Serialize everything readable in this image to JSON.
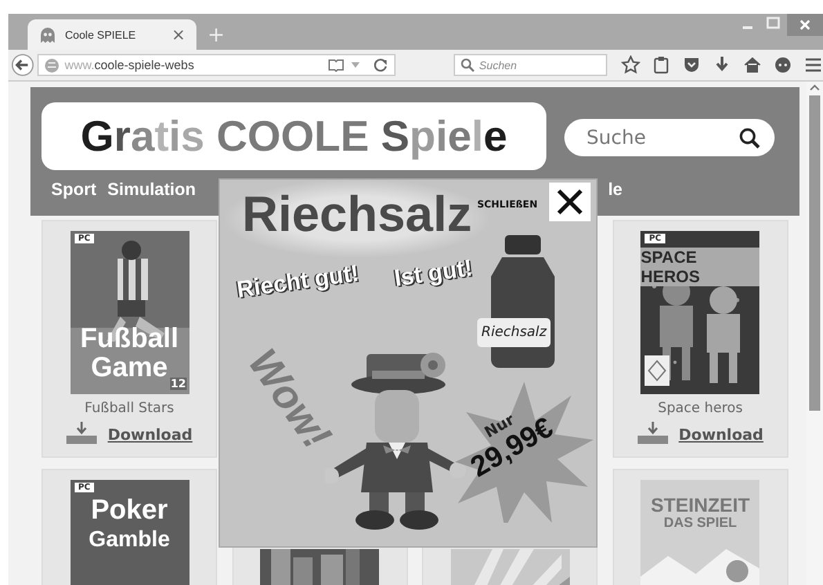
{
  "browser": {
    "tab": {
      "title": "Coole SPIELE",
      "close": "×"
    },
    "new_tab": "+",
    "address": {
      "url": "www.**coole-spiele-webs**"
    },
    "search": {
      "placeholder": "Suchen"
    }
  },
  "page": {
    "logo": [
      {
        "text": "G",
        "color": "#1e1e1e"
      },
      {
        "text": "r",
        "color": "#555555"
      },
      {
        "text": "a",
        "color": "#8a8a8a"
      },
      {
        "text": "t",
        "color": "#b4b4b4"
      },
      {
        "text": "i",
        "color": "#9a9a9a"
      },
      {
        "text": "s ",
        "color": "#a8a8a8"
      },
      {
        "text": "COOLE ",
        "color": "#7a7a7a"
      },
      {
        "text": "S",
        "color": "#5a5a5a"
      },
      {
        "text": "p",
        "color": "#9c9c9c"
      },
      {
        "text": "i",
        "color": "#8c8c8c"
      },
      {
        "text": "e",
        "color": "#7c7c7c"
      },
      {
        "text": "l",
        "color": "#b0b0b0"
      },
      {
        "text": "e",
        "color": "#1e1e1e"
      }
    ],
    "search": {
      "placeholder": "Suche"
    },
    "nav": [
      "Sport",
      "Simulation",
      "le"
    ],
    "rows": [
      {
        "cards": [
          {
            "pc": "PC",
            "title": [
              "Fußball",
              "Game"
            ],
            "age": "12",
            "caption": "Fußball Stars",
            "download": "Download"
          },
          {
            "pc": "PC",
            "title": [
              "SPACE HEROS"
            ],
            "caption": "Space heros",
            "download": "Download"
          }
        ]
      },
      {
        "cards": [
          {
            "pc": "PC",
            "title": [
              "Poker",
              "Gamble"
            ]
          },
          {
            "kind": "picture"
          },
          {
            "kind": "picture"
          },
          {
            "title": [
              "STEINZEIT",
              "DAS SPIEL"
            ]
          }
        ]
      }
    ],
    "ad": {
      "title": "Riechsalz",
      "close_label": "SCHLIEßEN",
      "slogans": [
        "Riecht gut!",
        "Ist gut!"
      ],
      "bottle_label": "Riechsalz",
      "exclaim": "Wow!",
      "price_prefix": "Nur",
      "price": "29,99€"
    }
  }
}
